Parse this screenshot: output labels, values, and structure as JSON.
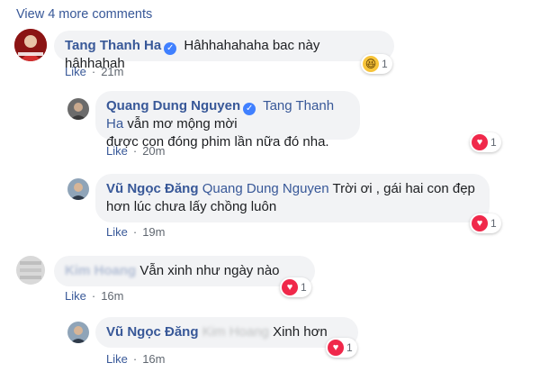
{
  "header": {
    "view_more": "View 4 more comments"
  },
  "comments": [
    {
      "author": "Tang Thanh Ha",
      "verified": true,
      "text": "Hâhhahahaha bac này hâhhahah",
      "like_label": "Like",
      "time": "21m",
      "reaction": {
        "type": "haha",
        "count": "1"
      }
    },
    {
      "author": "Quang Dung Nguyen",
      "verified": true,
      "mention": "Tang Thanh Ha",
      "text_line1": "vẫn mơ mộng mời",
      "text_line2": "được con đóng phim lần nữa đó nha.",
      "like_label": "Like",
      "time": "20m",
      "reaction": {
        "type": "love",
        "count": "1"
      }
    },
    {
      "author": "Vũ Ngọc Đăng",
      "mention": "Quang Dung Nguyen",
      "text_line1": "Trời ơi , gái hai con đẹp",
      "text_line2": "hơn lúc chưa lấy chồng luôn",
      "like_label": "Like",
      "time": "19m",
      "reaction": {
        "type": "love",
        "count": "1"
      }
    },
    {
      "author_blurred": "Kim Hoang",
      "text": "Vẫn xinh như ngày nào",
      "like_label": "Like",
      "time": "16m",
      "reaction": {
        "type": "love",
        "count": "1"
      }
    },
    {
      "author": "Vũ Ngọc Đăng",
      "mention_blurred": "Kim Hoang",
      "text": "Xinh hơn",
      "like_label": "Like",
      "time": "16m",
      "reaction": {
        "type": "love",
        "count": "1"
      }
    }
  ],
  "separator": "·",
  "colors": {
    "link": "#385898",
    "bubble": "#f2f3f5",
    "love": "#f0284a",
    "haha": "#f7c43a",
    "verified": "#4080ff"
  },
  "icons": {
    "verified": "verified-badge-icon",
    "haha": "haha-reaction-icon",
    "love": "love-reaction-icon"
  }
}
